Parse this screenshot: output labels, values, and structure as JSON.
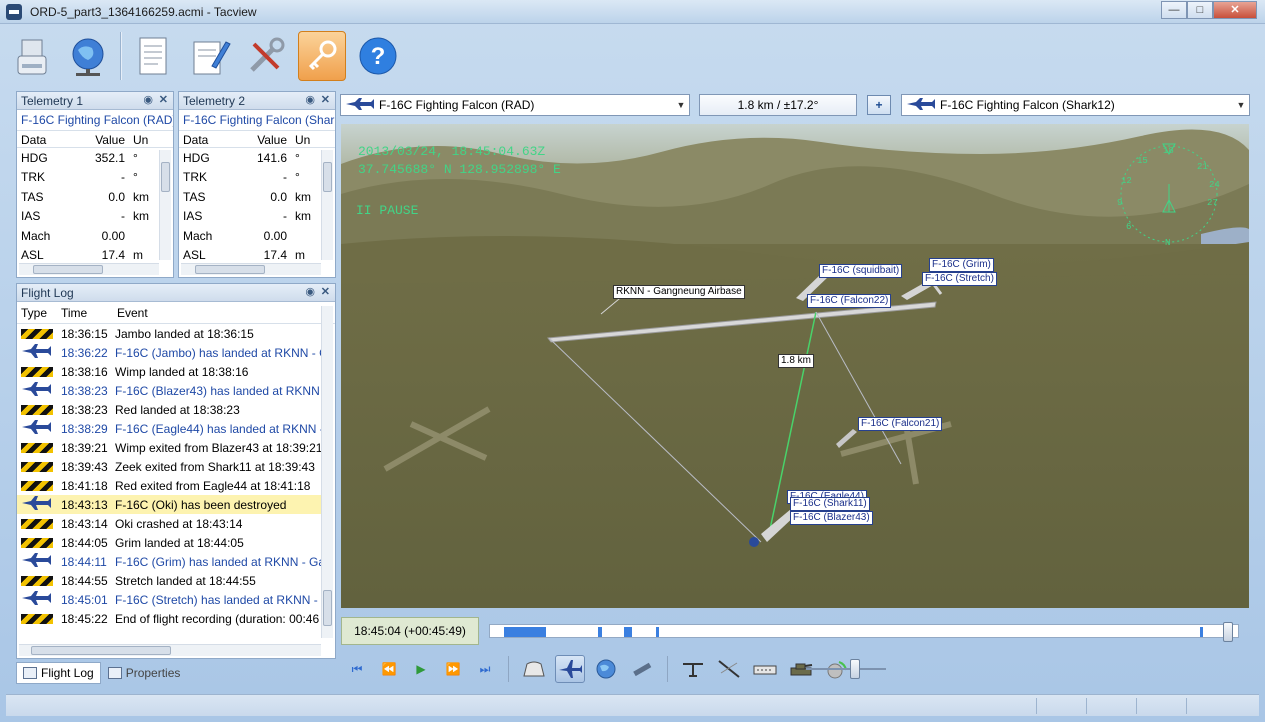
{
  "window": {
    "title": "ORD-5_part3_1364166259.acmi - Tacview",
    "buttons": [
      "minimize",
      "maximize",
      "close"
    ]
  },
  "toolbar": {
    "items": [
      "usb-drive-icon",
      "globe-network-icon",
      "document-icon",
      "notepad-pen-icon",
      "tools-icon",
      "key-icon",
      "help-icon"
    ],
    "active": "key-icon"
  },
  "telemetry1": {
    "title": "Telemetry 1",
    "object": "F-16C Fighting Falcon (RAD)",
    "columns": [
      "Data",
      "Value",
      "Un"
    ],
    "rows": [
      {
        "name": "HDG",
        "value": "352.1",
        "unit": "°"
      },
      {
        "name": "TRK",
        "value": "-",
        "unit": "°"
      },
      {
        "name": "TAS",
        "value": "0.0",
        "unit": "km"
      },
      {
        "name": "IAS",
        "value": "-",
        "unit": "km"
      },
      {
        "name": "Mach",
        "value": "0.00",
        "unit": ""
      },
      {
        "name": "ASL",
        "value": "17.4",
        "unit": "m"
      }
    ]
  },
  "telemetry2": {
    "title": "Telemetry 2",
    "object": "F-16C Fighting Falcon (Shar",
    "columns": [
      "Data",
      "Value",
      "Un"
    ],
    "rows": [
      {
        "name": "HDG",
        "value": "141.6",
        "unit": "°"
      },
      {
        "name": "TRK",
        "value": "-",
        "unit": "°"
      },
      {
        "name": "TAS",
        "value": "0.0",
        "unit": "km"
      },
      {
        "name": "IAS",
        "value": "-",
        "unit": "km"
      },
      {
        "name": "Mach",
        "value": "0.00",
        "unit": ""
      },
      {
        "name": "ASL",
        "value": "17.4",
        "unit": "m"
      }
    ]
  },
  "flight_log": {
    "title": "Flight Log",
    "columns": [
      "Type",
      "Time",
      "Event"
    ],
    "rows": [
      {
        "type": "hazard",
        "time": "18:36:15",
        "event": "Jambo landed at 18:36:15",
        "style": ""
      },
      {
        "type": "plane",
        "time": "18:36:22",
        "event": "F-16C (Jambo) has landed at RKNN - G",
        "style": "blue"
      },
      {
        "type": "hazard",
        "time": "18:38:16",
        "event": "Wimp landed at 18:38:16",
        "style": ""
      },
      {
        "type": "plane",
        "time": "18:38:23",
        "event": "F-16C (Blazer43) has landed at RKNN -",
        "style": "blue"
      },
      {
        "type": "hazard",
        "time": "18:38:23",
        "event": "Red landed at 18:38:23",
        "style": ""
      },
      {
        "type": "plane",
        "time": "18:38:29",
        "event": "F-16C (Eagle44) has landed at RKNN -",
        "style": "blue"
      },
      {
        "type": "hazard",
        "time": "18:39:21",
        "event": "Wimp exited from Blazer43 at 18:39:21",
        "style": ""
      },
      {
        "type": "hazard",
        "time": "18:39:43",
        "event": "Zeek exited from Shark11 at 18:39:43",
        "style": ""
      },
      {
        "type": "hazard",
        "time": "18:41:18",
        "event": "Red exited from Eagle44 at 18:41:18",
        "style": ""
      },
      {
        "type": "plane",
        "time": "18:43:13",
        "event": "F-16C (Oki) has been destroyed",
        "style": "hl"
      },
      {
        "type": "hazard",
        "time": "18:43:14",
        "event": "Oki crashed at 18:43:14",
        "style": ""
      },
      {
        "type": "hazard",
        "time": "18:44:05",
        "event": "Grim landed at 18:44:05",
        "style": ""
      },
      {
        "type": "plane",
        "time": "18:44:11",
        "event": "F-16C (Grim) has landed at RKNN - Ga",
        "style": "blue"
      },
      {
        "type": "hazard",
        "time": "18:44:55",
        "event": "Stretch landed at 18:44:55",
        "style": ""
      },
      {
        "type": "plane",
        "time": "18:45:01",
        "event": "F-16C (Stretch) has landed at RKNN - G",
        "style": "blue"
      },
      {
        "type": "hazard",
        "time": "18:45:22",
        "event": "End of flight recording (duration: 00:46",
        "style": ""
      }
    ]
  },
  "bottom_tabs": [
    "Flight Log",
    "Properties"
  ],
  "selector_left": "F-16C Fighting Falcon (RAD)",
  "range": "1.8 km / ±17.2°",
  "plus_label": "+",
  "selector_right": "F-16C Fighting Falcon (Shark12)",
  "viewport": {
    "datetime": "2013/03/24, 18:45:04.63Z",
    "coords": "37.745688° N  128.952898° E",
    "pause": "II PAUSE",
    "airbase_label": "RKNN - Gangneung Airbase",
    "distance_label": "1.8 km",
    "aircraft_labels": {
      "grim": "F-16C (Grim)",
      "stretch": "F-16C (Stretch)",
      "squidbait": "F-16C (squidbait)",
      "falcon22": "F-16C (Falcon22)",
      "falcon21": "F-16C (Falcon21)",
      "eagle44": "F-16C (Eagle44)",
      "shark11": "F-16C (Shark11)",
      "blazer43": "F-16C (Blazer43)"
    },
    "compass_labels": [
      "18",
      "21",
      "24",
      "27",
      "N",
      "6",
      "9",
      "12",
      "15"
    ]
  },
  "timeline": {
    "current": "18:45:04 (+00:45:49)",
    "position": 0.99
  }
}
